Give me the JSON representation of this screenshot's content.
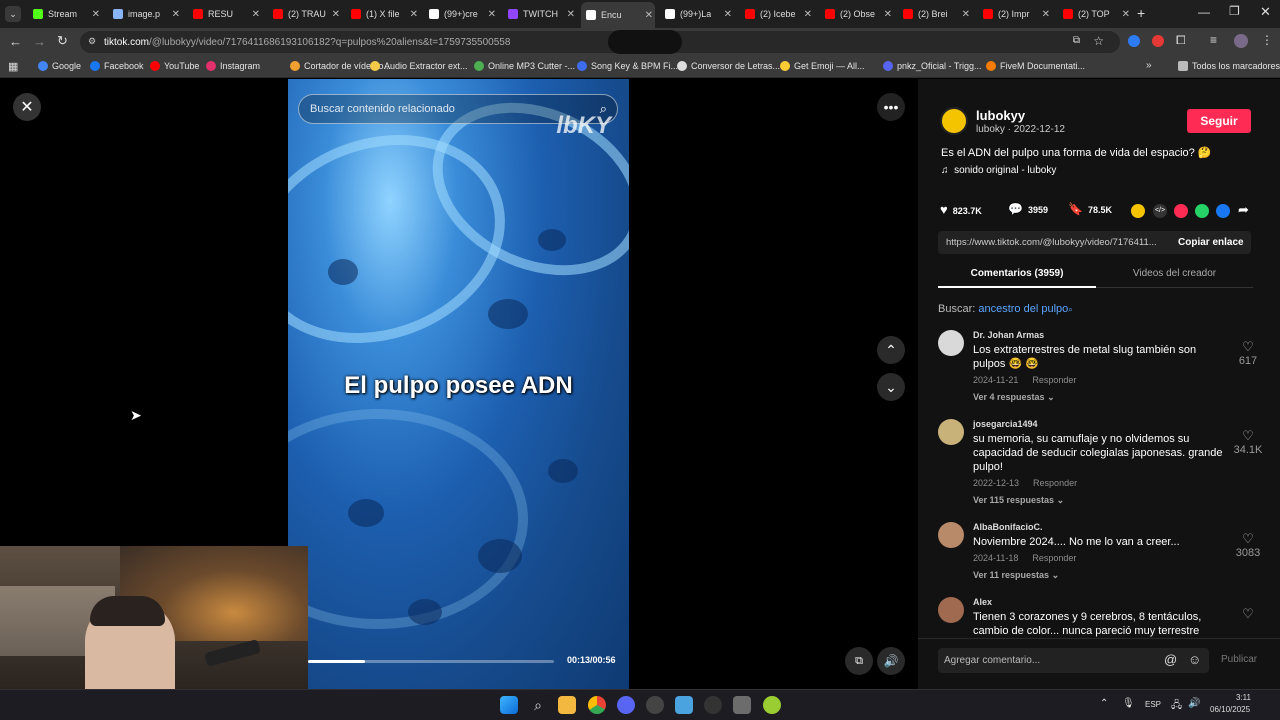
{
  "tabs": [
    {
      "label": "Stream",
      "color": "#53fc18",
      "active": false
    },
    {
      "label": "image.p",
      "color": "#8ab4f8",
      "active": false
    },
    {
      "label": "RESU",
      "color": "#ff0000",
      "active": false
    },
    {
      "label": "(2) TRAU",
      "color": "#ff0000",
      "active": false
    },
    {
      "label": "(1) X file",
      "color": "#ff0000",
      "active": false
    },
    {
      "label": "(99+)cre",
      "color": "#ffffff",
      "active": false
    },
    {
      "label": "TWITCH",
      "color": "#9146ff",
      "active": false
    },
    {
      "label": "Encu",
      "color": "#ffffff",
      "active": true
    },
    {
      "label": "(99+)La",
      "color": "#ffffff",
      "active": false
    },
    {
      "label": "(2) Icebe",
      "color": "#ff0000",
      "active": false
    },
    {
      "label": "(2) Obse",
      "color": "#ff0000",
      "active": false
    },
    {
      "label": "(2) Brei",
      "color": "#ff0000",
      "active": false
    },
    {
      "label": "(2) Impr",
      "color": "#ff0000",
      "active": false
    },
    {
      "label": "(2) TOP",
      "color": "#ff0000",
      "active": false
    }
  ],
  "address": {
    "host": "tiktok.com",
    "path": "/@lubokyy/video/7176411686193106182?q=pulpos%20aliens&t=1759735500558"
  },
  "bookmarks": [
    {
      "label": "Google",
      "color": "#4285f4"
    },
    {
      "label": "Facebook",
      "color": "#1877f2"
    },
    {
      "label": "YouTube",
      "color": "#ff0000"
    },
    {
      "label": "Instagram",
      "color": "#e1306c"
    },
    {
      "label": "Cortador de vídeo o...",
      "color": "#f0a030"
    },
    {
      "label": "Audio Extractor ext...",
      "color": "#f7c948"
    },
    {
      "label": "Online MP3 Cutter -...",
      "color": "#4caf50"
    },
    {
      "label": "Song Key & BPM Fi...",
      "color": "#3d6cf0"
    },
    {
      "label": "Conversor de Letras...",
      "color": "#dddddd"
    },
    {
      "label": "Get Emoji — All...",
      "color": "#ffcc33"
    },
    {
      "label": "pnkz_Oficial - Trigg...",
      "color": "#5865f2"
    },
    {
      "label": "FiveM Documentati...",
      "color": "#f57c00"
    }
  ],
  "all_bookmarks": "Todos los marcadores",
  "video": {
    "search_placeholder": "Buscar contenido relacionado",
    "watermark": "lbKY",
    "caption": "El pulpo posee ADN",
    "time": "00:13/00:56",
    "progress": 0.23
  },
  "author": {
    "name": "lubokyy",
    "handle": "luboky",
    "date": "2022-12-12",
    "follow": "Seguir"
  },
  "post": {
    "description": "Es el ADN del pulpo una forma de vida del espacio? 🤔",
    "sound": "sonido original - luboky"
  },
  "stats": {
    "likes": "823.7K",
    "comments": "3959",
    "saves": "78.5K"
  },
  "share": {
    "url": "https://www.tiktok.com/@lubokyy/video/7176411...",
    "copy": "Copiar enlace"
  },
  "tabs_panel": {
    "comments": "Comentarios (3959)",
    "creator_videos": "Videos del creador"
  },
  "search_line": {
    "prefix": "Buscar:",
    "term": "ancestro del pulpo"
  },
  "comments": [
    {
      "user": "Dr. Johan Armas",
      "text": "Los extraterrestres de metal slug también son pulpos 🤓 🤓",
      "date": "2024-11-21",
      "reply": "Responder",
      "replies": "Ver 4 respuestas",
      "likes": "617",
      "avatar": "#d9d9d9"
    },
    {
      "user": "josegarcia1494",
      "text": "su memoria, su camuflaje y no olvidemos su capacidad de seducir colegialas japonesas. grande pulpo!",
      "date": "2022-12-13",
      "reply": "Responder",
      "replies": "Ver 115 respuestas",
      "likes": "34.1K",
      "avatar": "#c9b27a"
    },
    {
      "user": "AlbaBonifacioC.",
      "text": "Noviembre 2024.... No me lo van a creer...",
      "date": "2024-11-18",
      "reply": "Responder",
      "replies": "Ver 11 respuestas",
      "likes": "3083",
      "avatar": "#b88a6a"
    },
    {
      "user": "Alex",
      "text": "Tienen 3 corazones y 9 cerebros, 8 tentáculos, cambio de color... nunca pareció muy terrestre",
      "date": "",
      "reply": "",
      "replies": "",
      "likes": "",
      "avatar": "#a06a50"
    }
  ],
  "comment_input": {
    "placeholder": "Agregar comentario...",
    "post": "Publicar"
  },
  "taskbar": {
    "lang": "ESP",
    "time": "3:11",
    "date": "06/10/2025"
  }
}
